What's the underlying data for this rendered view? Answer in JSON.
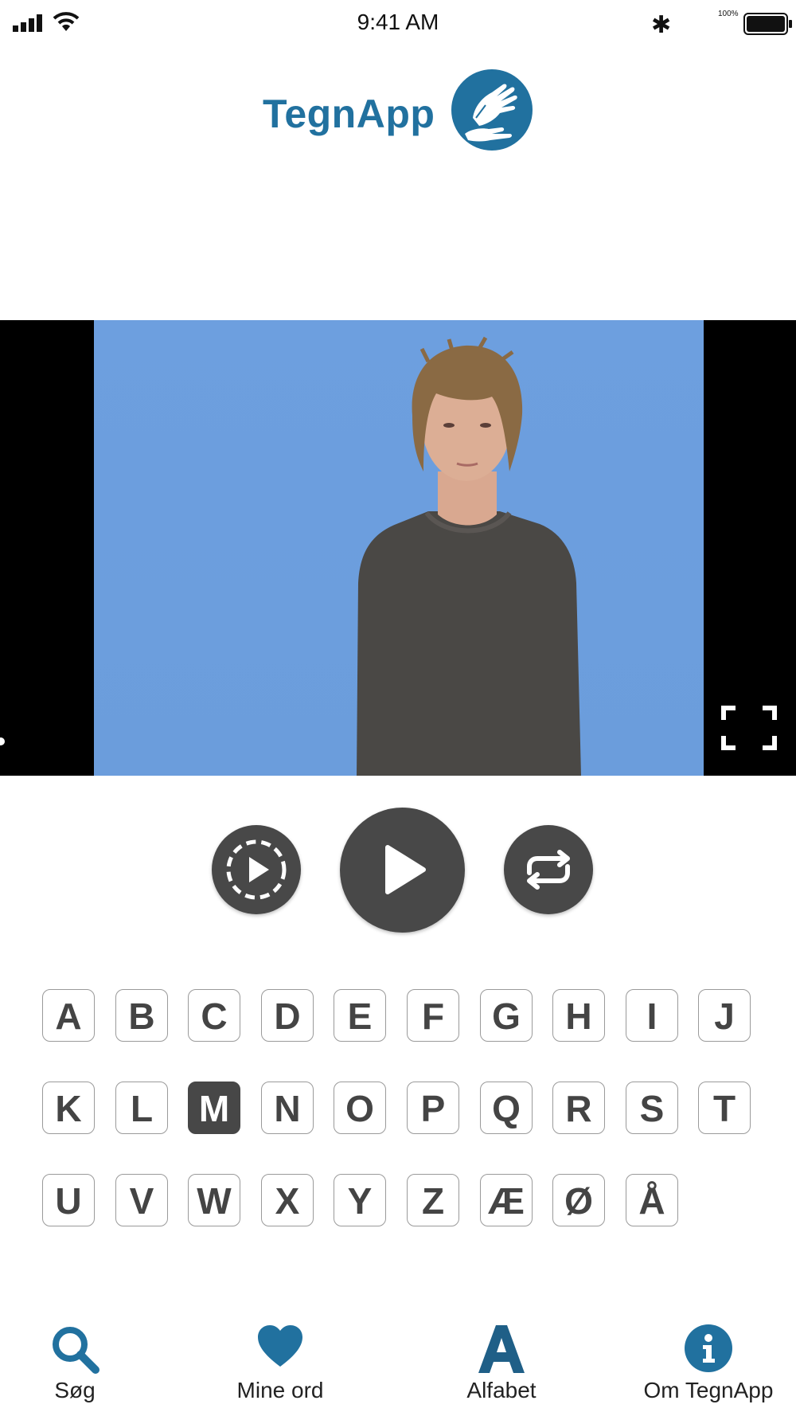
{
  "status_bar": {
    "time": "9:41 AM",
    "battery_percent": "100%",
    "icons": [
      "signal-icon",
      "wifi-icon",
      "bluetooth-icon",
      "battery-icon"
    ]
  },
  "header": {
    "app_name": "TegnApp",
    "logo_icon": "hands-icon",
    "brand_color": "#21719f"
  },
  "video": {
    "fullscreen_icon": "fullscreen-icon",
    "background_color": "#6d9fdf"
  },
  "controls": {
    "slow_play_icon": "slow-motion-play-icon",
    "play_icon": "play-icon",
    "repeat_icon": "repeat-icon",
    "button_color": "#484848"
  },
  "alphabet": {
    "row1": [
      "A",
      "B",
      "C",
      "D",
      "E",
      "F",
      "G",
      "H",
      "I",
      "J"
    ],
    "row2": [
      "K",
      "L",
      "M",
      "N",
      "O",
      "P",
      "Q",
      "R",
      "S",
      "T"
    ],
    "row3": [
      "U",
      "V",
      "W",
      "X",
      "Y",
      "Z",
      "Æ",
      "Ø",
      "Å"
    ],
    "selected": "M"
  },
  "tabs": [
    {
      "label": "Søg",
      "icon": "search-icon"
    },
    {
      "label": "Mine ord",
      "icon": "heart-icon"
    },
    {
      "label": "Alfabet",
      "icon": "alphabet-a-icon"
    },
    {
      "label": "Om TegnApp",
      "icon": "info-icon"
    }
  ]
}
